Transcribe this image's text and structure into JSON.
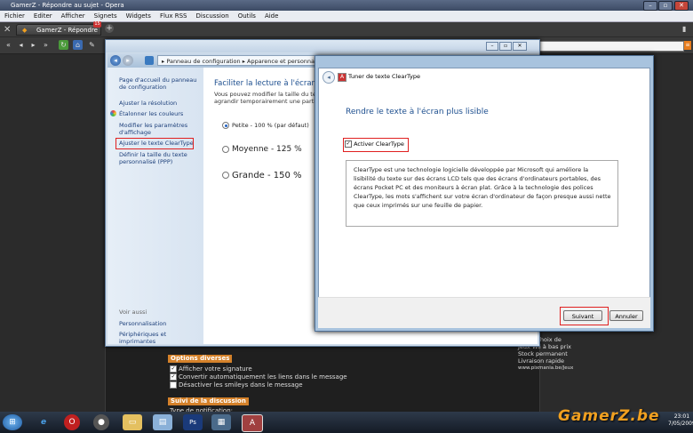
{
  "browser": {
    "title": "GamerZ - Répondre au sujet - Opera",
    "menu": [
      "Fichier",
      "Editer",
      "Afficher",
      "Signets",
      "Widgets",
      "Flux RSS",
      "Discussion",
      "Outils",
      "Aide"
    ],
    "tab_label": "GamerZ - Répondre au...",
    "tab_badge": "15"
  },
  "control_panel": {
    "breadcrumb": "▸ Panneau de configuration ▸ Apparence et personnalisation",
    "sidebar": {
      "home": "Page d'accueil du panneau de configuration",
      "links": [
        "Ajuster la résolution",
        "Étalonner les couleurs",
        "Modifier les paramètres d'affichage",
        "Ajuster le texte ClearType",
        "Définir la taille du texte personnalisé (PPP)"
      ],
      "see_also_label": "Voir aussi",
      "see_also": [
        "Personnalisation",
        "Périphériques et imprimantes"
      ]
    },
    "main": {
      "heading": "Faciliter la lecture à l'écran",
      "desc1": "Vous pouvez modifier la taille du texte e",
      "desc2": "agrandir temporairement une partie de",
      "options": [
        "Petite - 100 % (par défaut)",
        "Moyenne - 125 %",
        "Grande - 150 %"
      ]
    }
  },
  "cleartype_dialog": {
    "title": "Tuner de texte ClearType",
    "heading": "Rendre le texte à l'écran plus lisible",
    "checkbox_label": "Activer ClearType",
    "description": "ClearType est une technologie logicielle développée par Microsoft qui améliore la lisibilité du texte sur des écrans LCD tels que des écrans d'ordinateurs portables, des écrans Pocket PC et des moniteurs à écran plat. Grâce à la technologie des polices ClearType, les mots s'affichent sur votre écran d'ordinateur de façon presque aussi nette que ceux imprimés sur une feuille de papier.",
    "next_button": "Suivant",
    "cancel_button": "Annuler"
  },
  "forum": {
    "section_options": "Options diverses",
    "checkbox1": "Afficher votre signature",
    "checkbox2": "Convertir automatiquement les liens dans le message",
    "checkbox3": "Désactiver les smileys dans le message",
    "section_follow": "Suivi de la discussion",
    "notify_label": "Type de notification:"
  },
  "ad": {
    "text": "Large Choix de Jeux Wii à bas prix Stock permanent Livraison rapide",
    "url": "www.pixmania.be/Jeux"
  },
  "taskbar": {
    "time": "23:01",
    "date": "7/05/2009"
  },
  "watermark": "GamerZ.be"
}
